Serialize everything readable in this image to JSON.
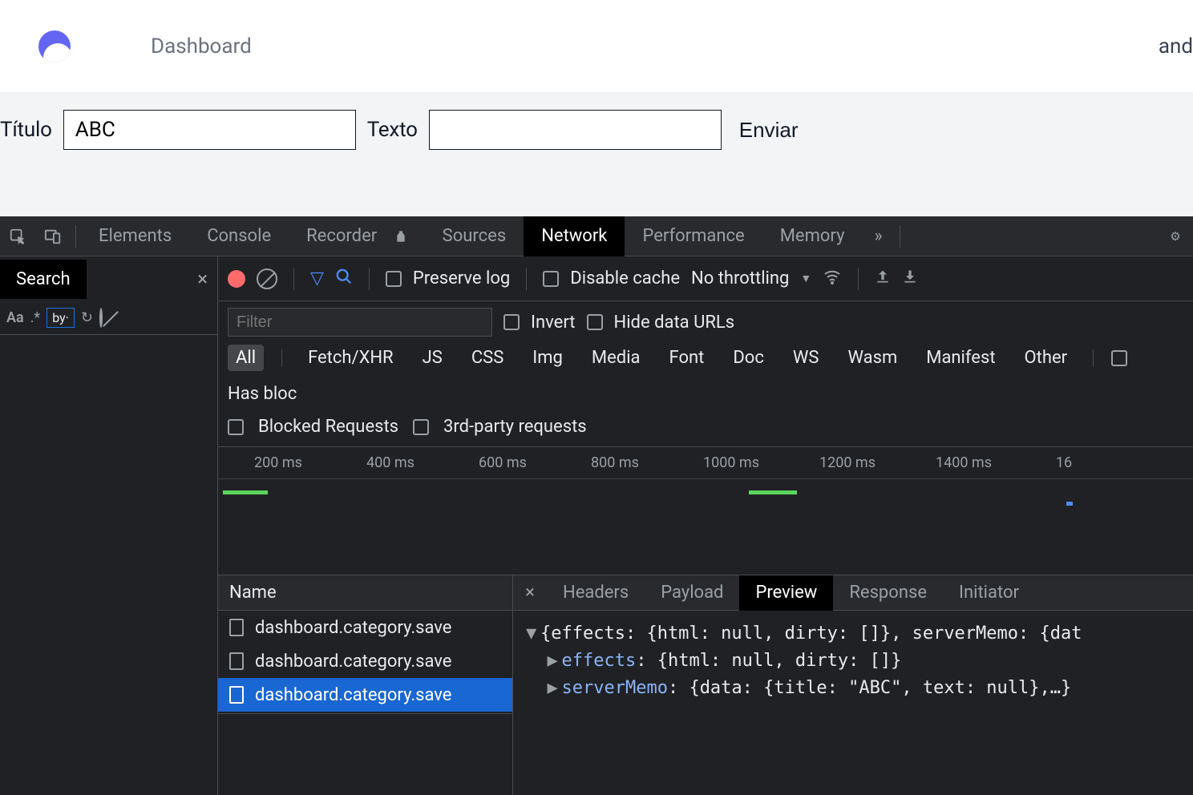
{
  "header": {
    "brand": "Dashboard",
    "right_text": "and"
  },
  "form": {
    "titulo_label": "Título",
    "titulo_value": "ABC",
    "texto_label": "Texto",
    "texto_value": "",
    "submit_label": "Enviar"
  },
  "devtools": {
    "tabs": {
      "elements": "Elements",
      "console": "Console",
      "recorder": "Recorder",
      "sources": "Sources",
      "network": "Network",
      "performance": "Performance",
      "memory": "Memory"
    },
    "search_panel": {
      "title": "Search",
      "aa": "Aa",
      "regex": ".*",
      "by": "by·"
    },
    "net_toolbar": {
      "preserve_log": "Preserve log",
      "disable_cache": "Disable cache",
      "throttling": "No throttling",
      "filter_placeholder": "Filter",
      "invert": "Invert",
      "hide_data_urls": "Hide data URLs",
      "has_blocked": "Has bloc",
      "blocked_requests": "Blocked Requests",
      "third_party": "3rd-party requests"
    },
    "net_filters": {
      "all": "All",
      "fetchxhr": "Fetch/XHR",
      "js": "JS",
      "css": "CSS",
      "img": "Img",
      "media": "Media",
      "font": "Font",
      "doc": "Doc",
      "ws": "WS",
      "wasm": "Wasm",
      "manifest": "Manifest",
      "other": "Other"
    },
    "timeline_ticks": [
      "200 ms",
      "400 ms",
      "600 ms",
      "800 ms",
      "1000 ms",
      "1200 ms",
      "1400 ms",
      "16"
    ],
    "request_list": {
      "header": "Name",
      "rows": [
        {
          "name": "dashboard.category.save",
          "selected": false
        },
        {
          "name": "dashboard.category.save",
          "selected": false
        },
        {
          "name": "dashboard.category.save",
          "selected": true
        }
      ]
    },
    "detail_tabs": {
      "headers": "Headers",
      "payload": "Payload",
      "preview": "Preview",
      "response": "Response",
      "initiator": "Initiator"
    },
    "preview": {
      "line1": "{effects: {html: null, dirty: []}, serverMemo: {dat",
      "effects_key": "effects",
      "effects_val": ": {html: null, dirty: []}",
      "servermemo_key": "serverMemo",
      "servermemo_val": ": {data: {title: \"ABC\", text: null},…}"
    }
  }
}
